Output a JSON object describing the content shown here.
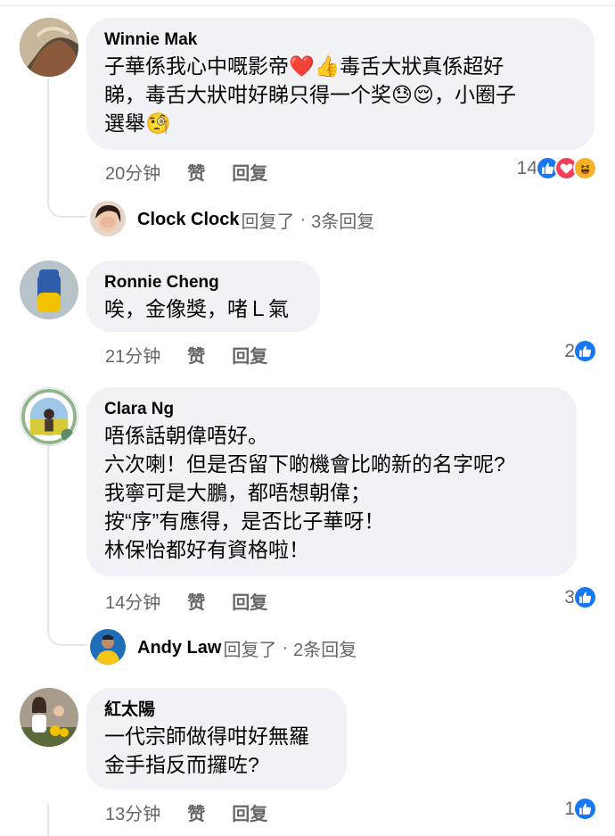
{
  "comments": [
    {
      "author": "Winnie Mak",
      "lines": [
        "子華係我心中嘅影帝❤️👍毒舌大狀真係超好",
        "睇，毒舌大狀咁好睇只得一个奖😓😌，小圈子",
        "選舉🧐"
      ],
      "time": "20分钟",
      "like_label": "赞",
      "reply_label": "回复",
      "reaction_count": "14",
      "reaction_icons": [
        "like-icon",
        "love-icon",
        "haha-icon"
      ],
      "replies": {
        "name": "Clock Clock",
        "action": "回复了",
        "count_text": "3条回复"
      }
    },
    {
      "author": "Ronnie Cheng",
      "lines": [
        "唉，金像獎，啫Ｌ氣"
      ],
      "time": "21分钟",
      "like_label": "赞",
      "reply_label": "回复",
      "reaction_count": "2",
      "reaction_icons": [
        "like-icon"
      ]
    },
    {
      "author": "Clara Ng",
      "lines": [
        "唔係話朝偉唔好。",
        "六次喇！但是否留下啲機會比啲新的名字呢?",
        "我寧可是大鵬，都唔想朝偉；",
        "按“序”有應得，是否比子華呀！",
        "林保怡都好有資格啦！"
      ],
      "time": "14分钟",
      "like_label": "赞",
      "reply_label": "回复",
      "reaction_count": "3",
      "reaction_icons": [
        "like-icon"
      ],
      "replies": {
        "name": "Andy Law",
        "action": "回复了",
        "count_text": "2条回复"
      }
    },
    {
      "author": "紅太陽",
      "lines": [
        "一代宗師做得咁好無羅",
        "金手指反而攞咗?"
      ],
      "time": "13分钟",
      "like_label": "赞",
      "reply_label": "回复",
      "reaction_count": "1",
      "reaction_icons": [
        "like-icon"
      ]
    }
  ],
  "colors": {
    "like": "#1877f2",
    "love": "#f33e58",
    "haha": "#f7b125",
    "bubble": "#f0f2f5",
    "meta": "#65676b"
  }
}
